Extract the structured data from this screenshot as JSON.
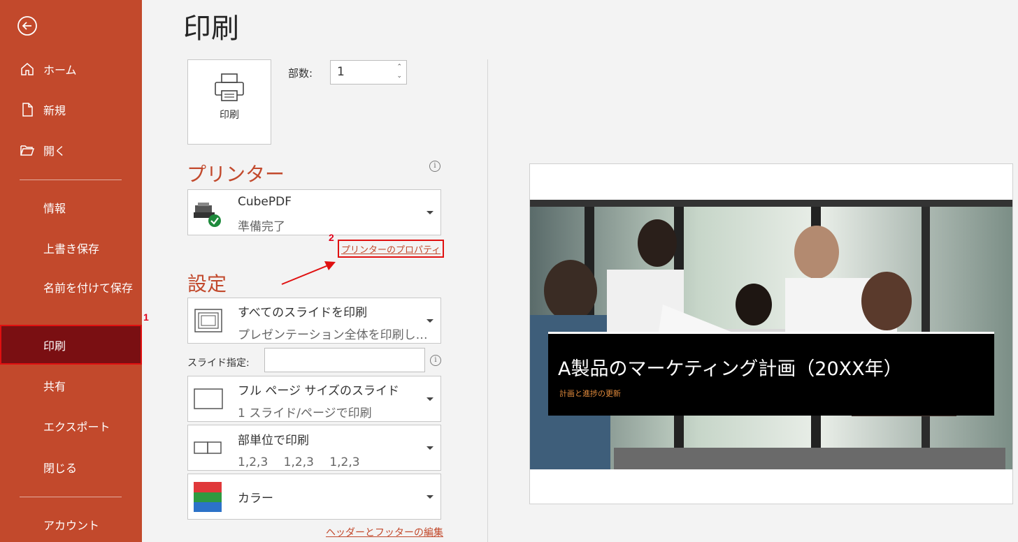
{
  "sidebar": {
    "items": [
      {
        "label": "ホーム",
        "icon": "home-icon"
      },
      {
        "label": "新規",
        "icon": "new-document-icon"
      },
      {
        "label": "開く",
        "icon": "folder-open-icon"
      },
      {
        "label": "情報"
      },
      {
        "label": "上書き保存"
      },
      {
        "label": "名前を付けて保存"
      },
      {
        "label": "印刷"
      },
      {
        "label": "共有"
      },
      {
        "label": "エクスポート"
      },
      {
        "label": "閉じる"
      },
      {
        "label": "アカウント"
      }
    ],
    "accent_color": "#c2492c",
    "active_color": "#7a0f12"
  },
  "annotations": {
    "step1": "1",
    "step2": "2"
  },
  "main": {
    "title": "印刷",
    "print_button_label": "印刷",
    "copies_label": "部数:",
    "copies_value": "1",
    "printer_heading": "プリンター",
    "printer": {
      "name": "CubePDF",
      "status": "準備完了"
    },
    "printer_properties_link": "プリンターのプロパティ",
    "settings_heading": "設定",
    "settings": [
      {
        "line1": "すべてのスライドを印刷",
        "line2": "プレゼンテーション全体を印刷し…"
      },
      {
        "line1": "フル ページ サイズのスライド",
        "line2": "1 スライド/ページで印刷"
      },
      {
        "line1": "部単位で印刷",
        "line2": "1,2,3　 1,2,3　 1,2,3"
      },
      {
        "line1": "カラー",
        "line2": ""
      }
    ],
    "slides_label": "スライド指定:",
    "slides_value": "",
    "header_footer_link": "ヘッダーとフッターの編集"
  },
  "preview": {
    "slide_title": "A製品のマーケティング計画（20XX年）",
    "slide_subtitle": "計画と進捗の更新"
  }
}
